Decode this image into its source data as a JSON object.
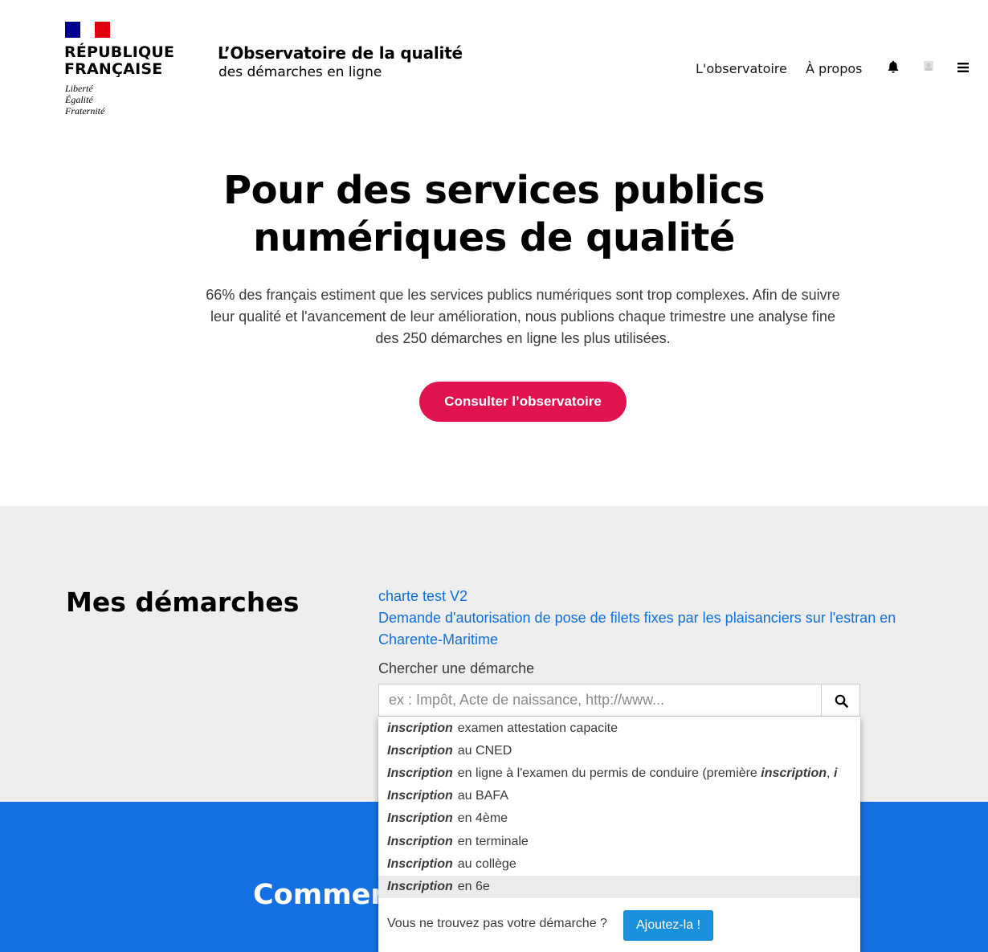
{
  "header": {
    "republique_line1": "RÉPUBLIQUE",
    "republique_line2": "FRANÇAISE",
    "motto": [
      "Liberté",
      "Égalité",
      "Fraternité"
    ],
    "site_title": "L’Observatoire de la qualité",
    "site_subtitle": "des démarches en ligne",
    "nav": [
      "L'observatoire",
      "À propos"
    ],
    "icons": [
      "bell-icon",
      "avatar-icon",
      "menu-icon"
    ]
  },
  "hero": {
    "title_line1": "Pour des services publics",
    "title_line2": "numériques de qualité",
    "text": "66% des français estiment que les services publics numériques sont trop complexes. Afin de suivre leur qualité et l'avancement de leur amélioration, nous publions chaque trimestre une analyse fine des 250 démarches en ligne les plus utilisées.",
    "cta_label": "Consulter l’observatoire"
  },
  "demarches": {
    "title": "Mes démarches",
    "links": [
      "charte test V2",
      "Demande d'autorisation de pose de filets fixes par les plaisanciers sur l'estran en Charente-Maritime"
    ],
    "search_label": "Chercher une démarche",
    "search_placeholder": "ex : Impôt, Acte de naissance, http://www..."
  },
  "autocomplete": {
    "items": [
      {
        "keyword": "inscription",
        "rest": "examen attestation capacite",
        "extra": ""
      },
      {
        "keyword": "Inscription",
        "rest": "au CNED",
        "extra": ""
      },
      {
        "keyword": "Inscription",
        "rest": "en ligne à l'examen du permis de conduire (première",
        "extra": "inscription"
      },
      {
        "keyword": "Inscription",
        "rest": "au BAFA",
        "extra": ""
      },
      {
        "keyword": "Inscription",
        "rest": "en 4ème",
        "extra": ""
      },
      {
        "keyword": "Inscription",
        "rest": "en terminale",
        "extra": ""
      },
      {
        "keyword": "Inscription",
        "rest": "au collège",
        "extra": ""
      },
      {
        "keyword": "Inscription",
        "rest": "en 6e",
        "extra": ""
      }
    ],
    "active_index": 7,
    "footer_text": "Vous ne trouvez pas votre démarche ?",
    "add_label": "Ajoutez-la !"
  },
  "blue_section": {
    "title_partial": "Commen"
  },
  "colors": {
    "cta": "#e1134f",
    "link": "#0f6fde",
    "blue_section": "#1470e3",
    "add_button": "#1a8fdb",
    "flag_blue": "#000091",
    "flag_red": "#e1000f"
  }
}
